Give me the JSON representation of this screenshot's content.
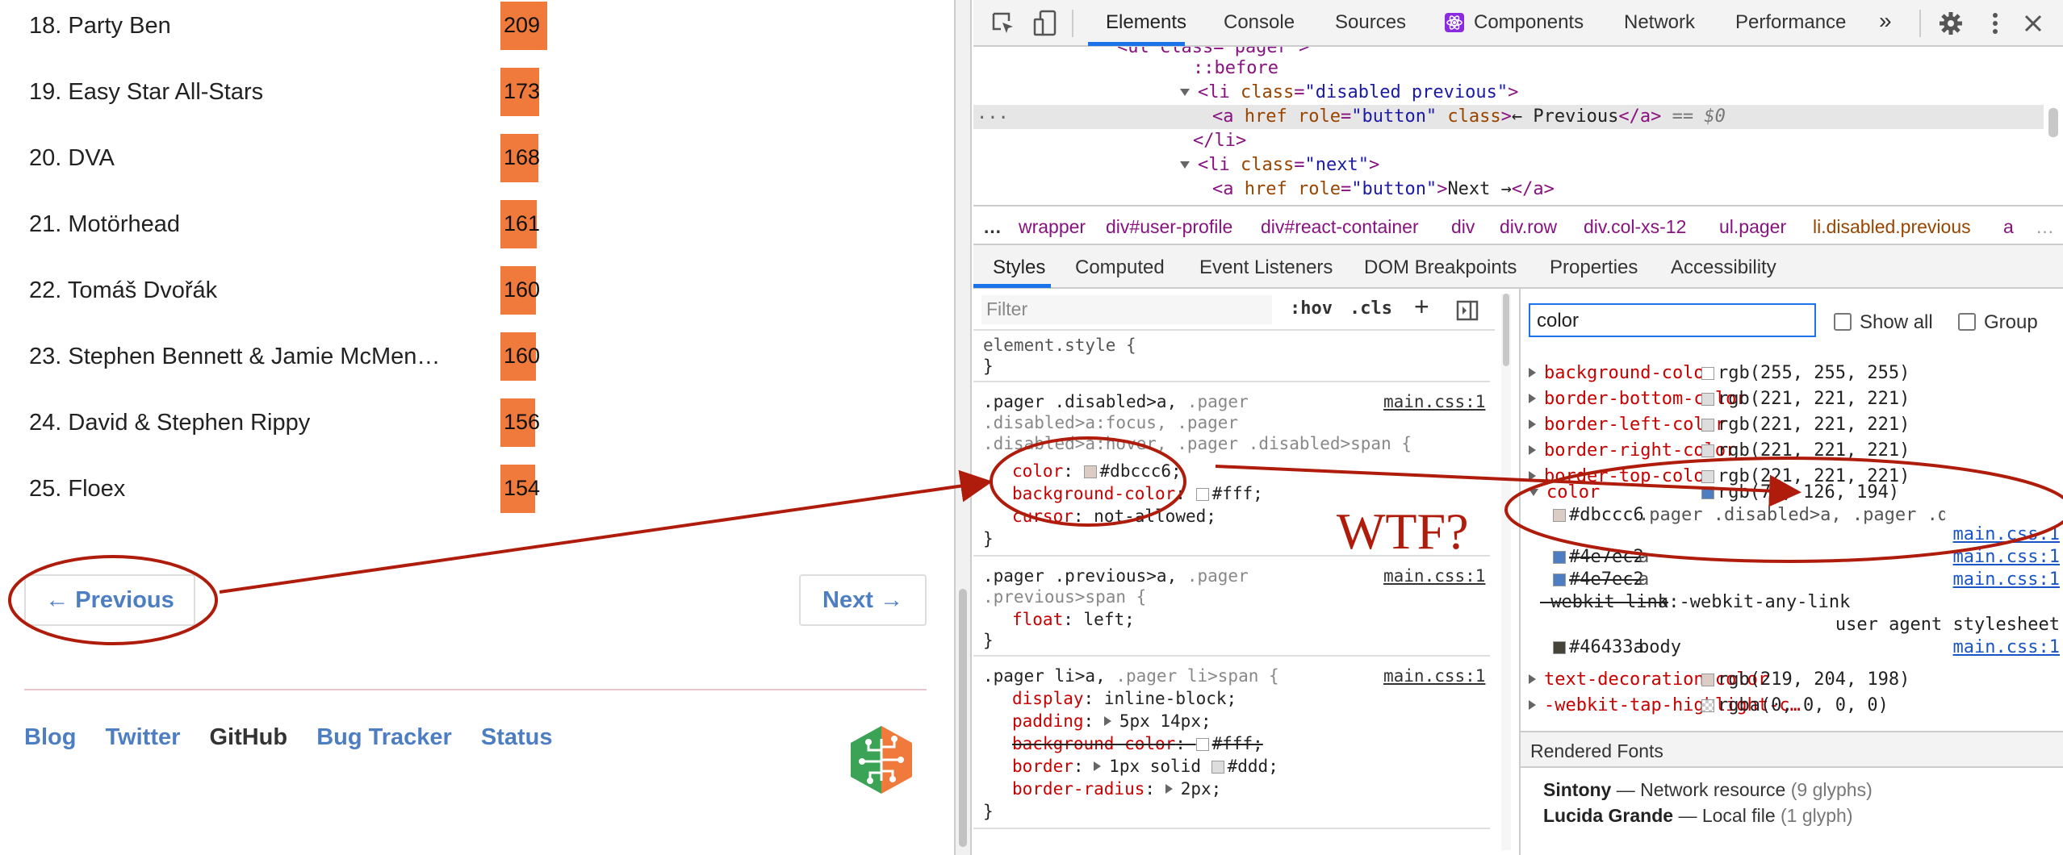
{
  "ranking": {
    "rows": [
      {
        "label": "18. Party Ben",
        "value": 209
      },
      {
        "label": "19. Easy Star All-Stars",
        "value": 173
      },
      {
        "label": "20. DVA",
        "value": 168
      },
      {
        "label": "21. Motörhead",
        "value": 161
      },
      {
        "label": "22. Tomáš Dvořák",
        "value": 160
      },
      {
        "label": "23. Stephen Bennett & Jamie McMen…",
        "value": 160
      },
      {
        "label": "24. David & Stephen Rippy",
        "value": 156
      },
      {
        "label": "25. Floex",
        "value": 154
      }
    ]
  },
  "pager": {
    "previous": "← Previous",
    "next": "Next →"
  },
  "footer": {
    "blog": "Blog",
    "twitter": "Twitter",
    "github": "GitHub",
    "bug_tracker": "Bug Tracker",
    "status": "Status"
  },
  "devtools": {
    "tabs": [
      "Elements",
      "Console",
      "Sources",
      "Components",
      "Network",
      "Performance",
      "»"
    ],
    "dom": {
      "l0": "<ul class=\"pager\">",
      "l1": "::before",
      "l2_tag": "<li",
      "l2_attr": " class",
      "l2_eq": "=",
      "l2_val": "\"disabled previous\"",
      "l2_end": ">",
      "l3_a": "<a",
      "l3_href": " href",
      "l3_role": " role",
      "l3_eq": "=",
      "l3_rv": "\"button\"",
      "l3_cls": " class",
      "l3_gt": ">",
      "l3_text": "← Previous",
      "l3_close": "</a>",
      "l3_eq0": " == $0",
      "l4": "</li>",
      "l5_tag": "<li",
      "l5_attr": " class",
      "l5_eq": "=",
      "l5_val": "\"next\"",
      "l5_end": ">",
      "l6_a": "<a",
      "l6_href": " href",
      "l6_role": " role",
      "l6_eq": "=",
      "l6_rv": "\"button\"",
      "l6_gt": ">",
      "l6_text": "Next →",
      "l6_close": "</a>",
      "dots": "..."
    },
    "breadcrumbs": [
      "…",
      "wrapper",
      "div#user-profile",
      "div#react-container",
      "div",
      "div.row",
      "div.col-xs-12",
      "ul.pager",
      "li.disabled.previous",
      "a",
      "…"
    ],
    "subtabs": [
      "Styles",
      "Computed",
      "Event Listeners",
      "DOM Breakpoints",
      "Properties",
      "Accessibility"
    ],
    "styles": {
      "filter_placeholder": "Filter",
      "hov": ":hov",
      "cls": ".cls",
      "plus": "+",
      "r0_sel": "element.style {",
      "r0_end": "}",
      "r1_sel1": ".pager .disabled>a,",
      "r1_sel1b": " .pager",
      "r1_sel2": ".disabled>a:focus, .pager",
      "r1_sel3": ".disabled>a:hover, .pager .disabled>span {",
      "r1_src": "main.css:1",
      "r1_p1": "color",
      "r1_v1": "#dbccc6;",
      "r1_p2": "background-color",
      "r1_v2": "#fff;",
      "r1_p3": "cursor",
      "r1_v3": "not-allowed;",
      "r1_end": "}",
      "r2_sel1": ".pager .previous>a,",
      "r2_sel1b": " .pager",
      "r2_sel2": ".previous>span {",
      "r2_src": "main.css:1",
      "r2_p1": "float",
      "r2_v1": "left;",
      "r2_end": "}",
      "r3_sel1": ".pager li>a,",
      "r3_sel1b": " .pager li>span {",
      "r3_src": "main.css:1",
      "r3_p1": "display",
      "r3_v1": "inline-block;",
      "r3_p2": "padding",
      "r3_v2": "5px 14px;",
      "r3_p3": "background-color",
      "r3_v3": "#fff;",
      "r3_p4": "border",
      "r3_v4": "1px solid",
      "r3_v4b": "#ddd;",
      "r3_p5": "border-radius",
      "r3_v5": "2px;",
      "r3_end": "}",
      "colon": ":"
    },
    "computed": {
      "filter_value": "color",
      "show_all": "Show all",
      "group": "Group",
      "rows": [
        {
          "prop": "background-color",
          "value": "rgb(255, 255, 255)",
          "swatch": "#ffffff"
        },
        {
          "prop": "border-bottom-color",
          "value": "rgb(221, 221, 221)",
          "swatch": "#dddddd"
        },
        {
          "prop": "border-left-color",
          "value": "rgb(221, 221, 221)",
          "swatch": "#dddddd"
        },
        {
          "prop": "border-right-color",
          "value": "rgb(221, 221, 221)",
          "swatch": "#dddddd"
        },
        {
          "prop": "border-top-color",
          "value": "rgb(221, 221, 221)",
          "swatch": "#dddddd"
        }
      ],
      "color_prop": "color",
      "color_value": "rgb(78, 126, 194)",
      "color_swatch": "#4e7ec2",
      "trace": [
        {
          "val": "#dbccc6",
          "sel": ".pager .disabled>a, .pager .dis",
          "src": "main.css:1",
          "swatch": "#dbccc6"
        },
        {
          "val": "#4e7ec2",
          "sel": "a",
          "src": "main.css:1",
          "swatch": "#4e7ec2"
        },
        {
          "val": "#4e7ec2",
          "sel": "a",
          "src": "main.css:1",
          "swatch": "#4e7ec2"
        }
      ],
      "webkit_link": "-webkit-link",
      "webkit_sel": "a:-webkit-any-link",
      "ua": "user agent stylesheet",
      "body_val": "#46433a",
      "body_sel": "body",
      "body_src": "main.css:1",
      "body_swatch": "#46433a",
      "tdc_prop": "text-decoration-color",
      "tdc_val": "rgb(219, 204, 198)",
      "tdc_swatch": "#dbccc6",
      "wth_prop": "-webkit-tap-highlight-c…",
      "wth_val": "rgba(0, 0, 0, 0)",
      "rendered_fonts": "Rendered Fonts",
      "font1_name": "Sintony",
      "font1_desc": "Network resource",
      "font1_count": "(9 glyphs)",
      "font2_name": "Lucida Grande",
      "font2_desc": "Local file",
      "font2_count": "(1 glyph)",
      "dash": "—"
    }
  },
  "annotation": {
    "text": "WTF?",
    "color": "#b01c0c"
  },
  "colors": {
    "bar": "#ef7a3c",
    "link": "#4e7ec2",
    "accent": "#1a73e8"
  }
}
